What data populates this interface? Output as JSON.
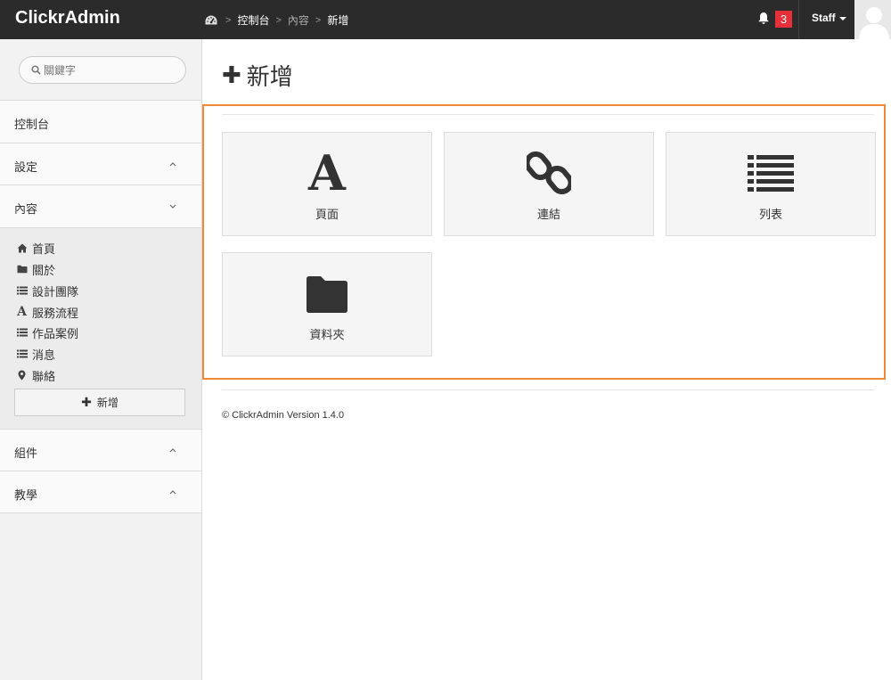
{
  "app": {
    "title": "ClickrAdmin"
  },
  "breadcrumb": {
    "items": [
      "控制台",
      "內容",
      "新增"
    ]
  },
  "header": {
    "notification_count": "3",
    "user_label": "Staff"
  },
  "sidebar": {
    "search_placeholder": "關鍵字",
    "items": [
      {
        "label": "控制台"
      },
      {
        "label": "設定"
      },
      {
        "label": "內容"
      },
      {
        "label": "組件"
      },
      {
        "label": "教學"
      }
    ],
    "content_children": [
      {
        "label": "首頁",
        "icon": "home-icon"
      },
      {
        "label": "關於",
        "icon": "folder-icon"
      },
      {
        "label": "設計團隊",
        "icon": "list-icon"
      },
      {
        "label": "服務流程",
        "icon": "font-icon"
      },
      {
        "label": "作品案例",
        "icon": "list-icon"
      },
      {
        "label": "消息",
        "icon": "list-icon"
      },
      {
        "label": "聯絡",
        "icon": "map-marker-icon"
      }
    ],
    "add_label": "新增"
  },
  "main": {
    "title": "新增",
    "tiles": [
      {
        "label": "頁面",
        "icon": "font-icon"
      },
      {
        "label": "連結",
        "icon": "link-icon"
      },
      {
        "label": "列表",
        "icon": "list-icon"
      },
      {
        "label": "資料夾",
        "icon": "folder-icon"
      }
    ]
  },
  "footer": {
    "text": "© ClickrAdmin Version 1.4.0"
  },
  "colors": {
    "topbar": "#2b2b2b",
    "badge": "#e8303b",
    "highlight": "#f0883a"
  }
}
